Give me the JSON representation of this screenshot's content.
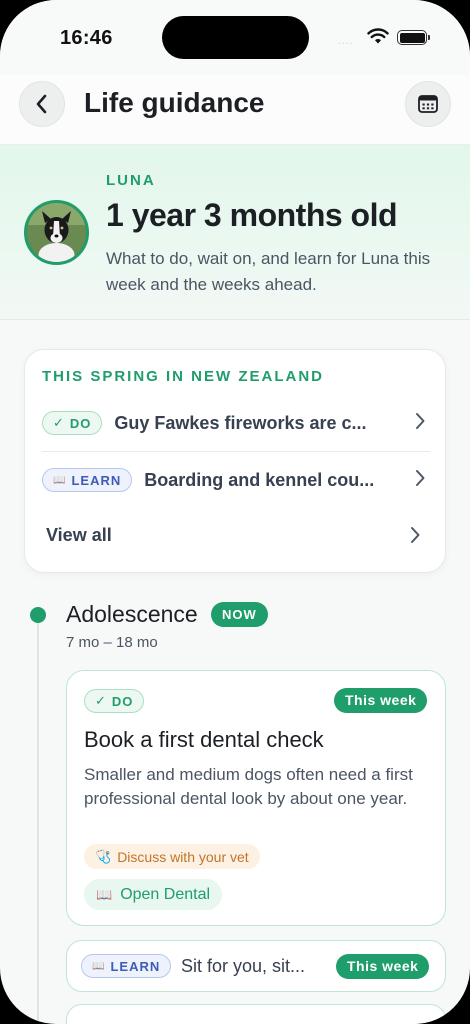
{
  "status_bar": {
    "time": "16:46",
    "signal": "....",
    "wifi_icon": "wifi-icon",
    "battery_icon": "battery-icon"
  },
  "nav": {
    "title": "Life guidance",
    "back_icon": "chevron-left-icon",
    "calendar_icon": "calendar-icon"
  },
  "pet": {
    "name": "LUNA",
    "age": "1 year 3 months old",
    "description": "What to do, wait on, and learn for Luna this week and the weeks ahead."
  },
  "season": {
    "title": "THIS SPRING IN NEW ZEALAND",
    "items": [
      {
        "chip_icon": "✓",
        "chip_label": "DO",
        "text": "Guy Fawkes fireworks are c..."
      },
      {
        "chip_icon": "📖",
        "chip_label": "LEARN",
        "text": "Boarding and kennel cou..."
      }
    ],
    "view_all": "View all"
  },
  "stage": {
    "title": "Adolescence",
    "badge": "NOW",
    "range": "7 mo – 18 mo"
  },
  "task1": {
    "chip_icon": "✓",
    "chip_label": "DO",
    "week_badge": "This week",
    "title": "Book a first dental check",
    "description": "Smaller and medium dogs often need a first professional dental look by about one year.",
    "vet_icon": "🩺",
    "vet_label": "Discuss with your vet",
    "open_icon": "📖",
    "open_label": "Open Dental"
  },
  "task2": {
    "chip_icon": "📖",
    "chip_label": "LEARN",
    "text": "Sit for you, sit...",
    "week_badge": "This week"
  },
  "colors": {
    "accent": "#1f9d6b",
    "learn": "#3d5cb8",
    "vet": "#c2742a"
  }
}
